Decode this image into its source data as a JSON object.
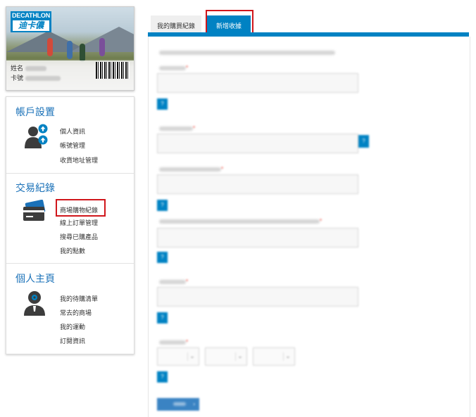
{
  "card": {
    "brand_top": "DECATHLON",
    "brand_bottom": "迪卡儂",
    "name_label": "姓名",
    "card_no_label": "卡號"
  },
  "sidebar": {
    "sections": [
      {
        "title": "帳戶設置",
        "icon": "user-upload-icon",
        "links": [
          "個人資訊",
          "帳號管理",
          "收貨地址管理"
        ]
      },
      {
        "title": "交易紀錄",
        "icon": "credit-card-icon",
        "links": [
          "商場購物紀錄",
          "線上訂單管理",
          "搜尋已購產品",
          "我的點數"
        ]
      },
      {
        "title": "個人主頁",
        "icon": "user-gear-icon",
        "links": [
          "我的待購清單",
          "常去的商場",
          "我的運動",
          "訂閱資訊"
        ]
      }
    ],
    "highlighted_link": "商場購物紀錄"
  },
  "tabs": [
    {
      "label": "我的購買紀錄",
      "active": false
    },
    {
      "label": "新增收據",
      "active": true
    }
  ],
  "colors": {
    "accent": "#0082c3",
    "section_title": "#1a71b8",
    "highlight": "#d0161b"
  }
}
